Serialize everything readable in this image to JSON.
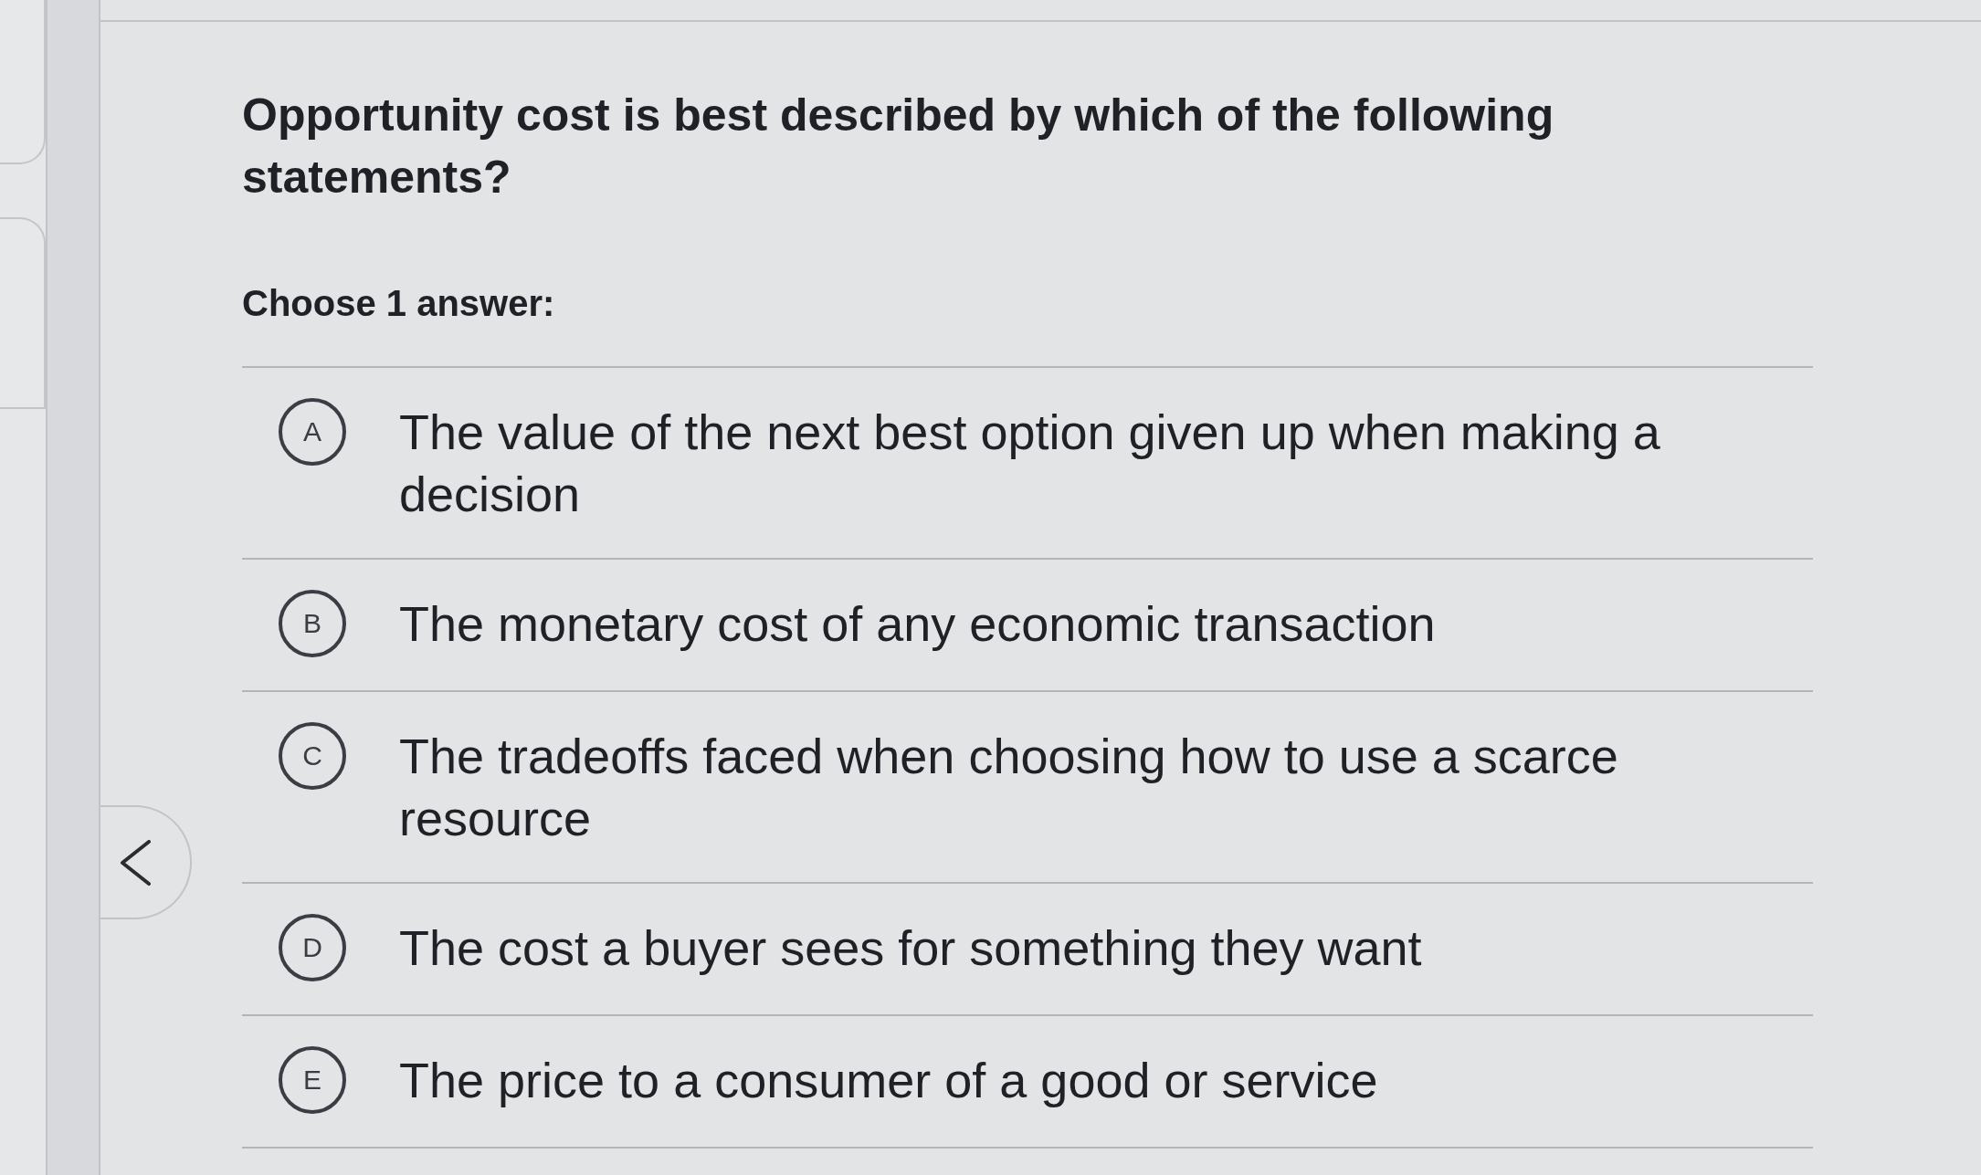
{
  "question": {
    "text": "Opportunity cost is best described by which of the following statements?"
  },
  "instruction": "Choose 1 answer:",
  "choices": [
    {
      "letter": "A",
      "text": "The value of the next best option given up when making a decision",
      "selected": false
    },
    {
      "letter": "B",
      "text": "The monetary cost of any economic transaction",
      "selected": false
    },
    {
      "letter": "C",
      "text": "The tradeoffs faced when choosing how to use a scarce resource",
      "selected": false
    },
    {
      "letter": "D",
      "text": "The cost a buyer sees for something they want",
      "selected": false
    },
    {
      "letter": "E",
      "text": "The price to a consumer of a good or service",
      "selected": false
    }
  ]
}
